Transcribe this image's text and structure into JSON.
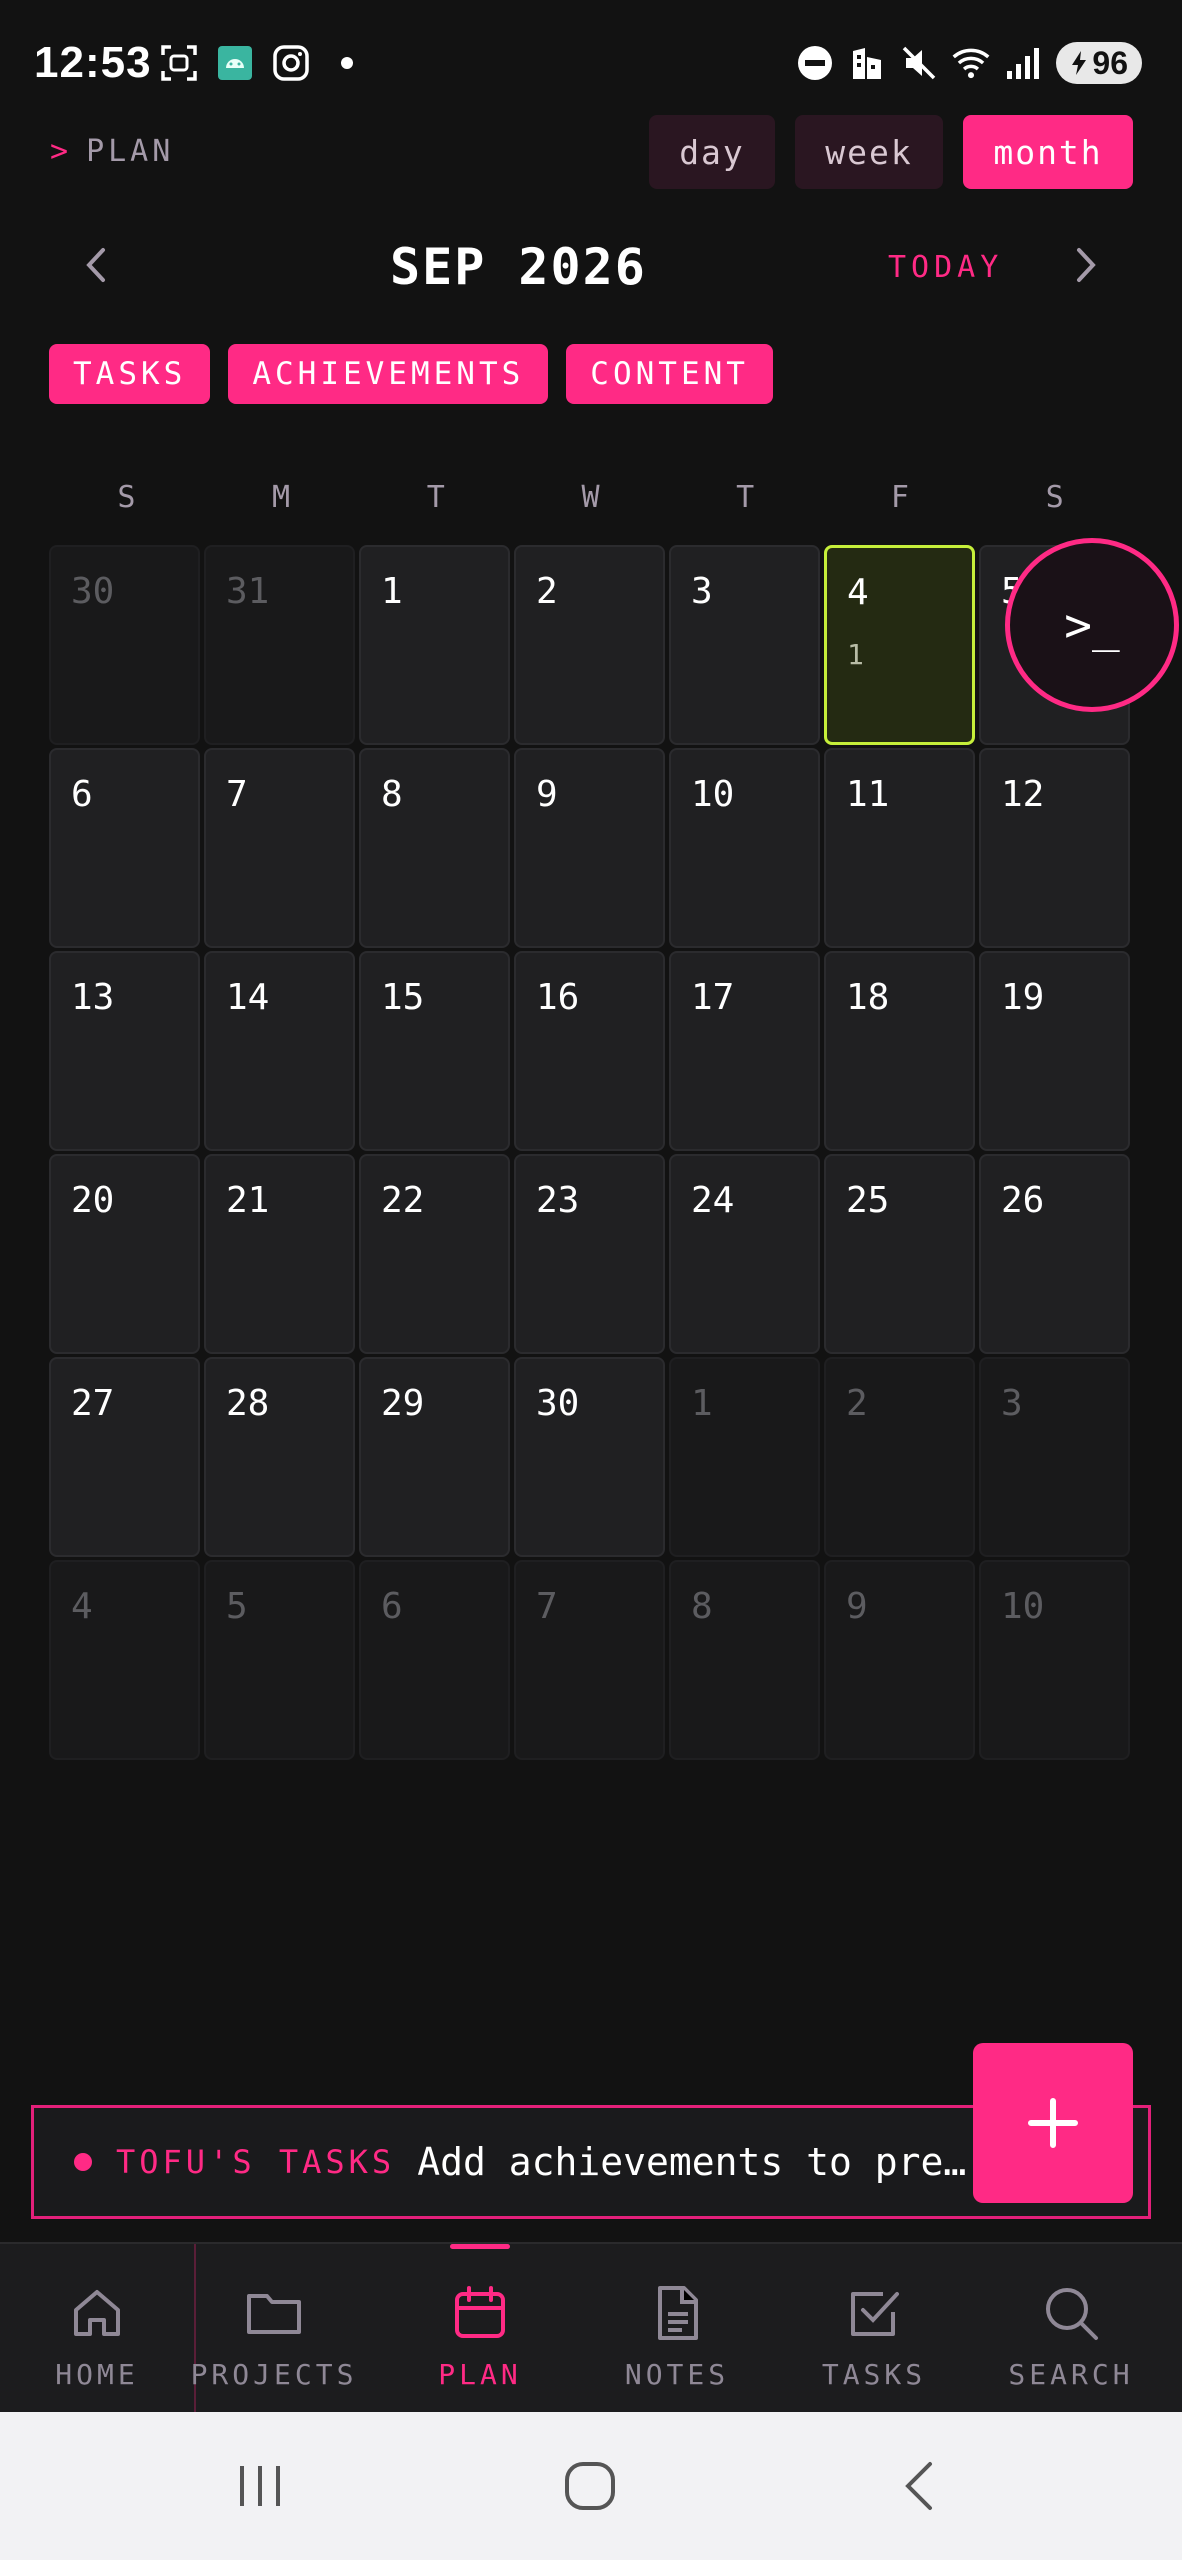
{
  "status_bar": {
    "time": "12:53",
    "battery": "96",
    "icons": [
      "screenshot-icon",
      "android-icon",
      "instagram-icon",
      "dot-icon",
      "dnd-icon",
      "building-icon",
      "mute-icon",
      "wifi-icon",
      "signal-icon"
    ]
  },
  "header": {
    "caret": ">",
    "section": "PLAN",
    "views": {
      "day": "day",
      "week": "week",
      "month": "month",
      "active": "month"
    }
  },
  "month_nav": {
    "title": "SEP 2026",
    "today_label": "TODAY"
  },
  "filters": [
    "TASKS",
    "ACHIEVEMENTS",
    "CONTENT"
  ],
  "calendar": {
    "weekdays": [
      "S",
      "M",
      "T",
      "W",
      "T",
      "F",
      "S"
    ],
    "days": [
      {
        "n": "30",
        "other": true
      },
      {
        "n": "31",
        "other": true
      },
      {
        "n": "1"
      },
      {
        "n": "2"
      },
      {
        "n": "3"
      },
      {
        "n": "4",
        "today": true,
        "count": "1"
      },
      {
        "n": "5"
      },
      {
        "n": "6"
      },
      {
        "n": "7"
      },
      {
        "n": "8"
      },
      {
        "n": "9"
      },
      {
        "n": "10"
      },
      {
        "n": "11"
      },
      {
        "n": "12"
      },
      {
        "n": "13"
      },
      {
        "n": "14"
      },
      {
        "n": "15"
      },
      {
        "n": "16"
      },
      {
        "n": "17"
      },
      {
        "n": "18"
      },
      {
        "n": "19"
      },
      {
        "n": "20"
      },
      {
        "n": "21"
      },
      {
        "n": "22"
      },
      {
        "n": "23"
      },
      {
        "n": "24"
      },
      {
        "n": "25"
      },
      {
        "n": "26"
      },
      {
        "n": "27"
      },
      {
        "n": "28"
      },
      {
        "n": "29"
      },
      {
        "n": "30"
      },
      {
        "n": "1",
        "other": true
      },
      {
        "n": "2",
        "other": true
      },
      {
        "n": "3",
        "other": true
      },
      {
        "n": "4",
        "other": true
      },
      {
        "n": "5",
        "other": true
      },
      {
        "n": "6",
        "other": true
      },
      {
        "n": "7",
        "other": true
      },
      {
        "n": "8",
        "other": true
      },
      {
        "n": "9",
        "other": true
      },
      {
        "n": "10",
        "other": true
      }
    ]
  },
  "terminal_fab": {
    "label": ">_"
  },
  "task_banner": {
    "tag": "TOFU'S TASKS",
    "text": "Add achievements to pre…"
  },
  "add_fab": {
    "icon": "plus-icon"
  },
  "bottom_nav": {
    "items": [
      {
        "label": "HOME",
        "icon": "home-icon"
      },
      {
        "label": "PROJECTS",
        "icon": "folder-icon"
      },
      {
        "label": "PLAN",
        "icon": "calendar-icon",
        "active": true
      },
      {
        "label": "NOTES",
        "icon": "document-icon"
      },
      {
        "label": "TASKS",
        "icon": "checkbox-icon"
      },
      {
        "label": "SEARCH",
        "icon": "search-icon"
      }
    ]
  },
  "colors": {
    "accent": "#ff2a85",
    "today_border": "#c6ef3a",
    "background": "#121212"
  }
}
